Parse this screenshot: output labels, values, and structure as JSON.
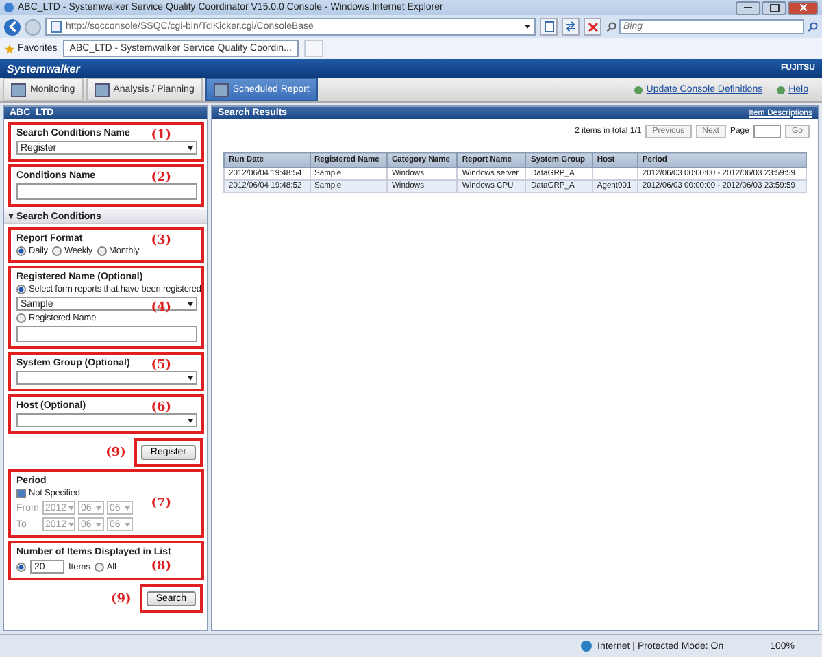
{
  "window": {
    "title": "ABC_LTD - Systemwalker Service Quality Coordinator V15.0.0 Console - Windows Internet Explorer"
  },
  "address_bar": {
    "url": "http://sqcconsole/SSQC/cgi-bin/TclKicker.cgi/ConsoleBase"
  },
  "search_box": {
    "placeholder": "Bing"
  },
  "favorites_bar": {
    "label": "Favorites",
    "tabs": [
      {
        "label": "ABC_LTD - Systemwalker Service Quality Coordin...",
        "selected": true
      }
    ]
  },
  "banner": {
    "logo": "Systemwalker",
    "brand": "FUJITSU"
  },
  "nav_tabs": [
    {
      "label": "Monitoring",
      "selected": false
    },
    {
      "label": "Analysis / Planning",
      "selected": false
    },
    {
      "label": "Scheduled Report",
      "selected": true
    }
  ],
  "nav_links": [
    "Update Console Definitions",
    "Help"
  ],
  "search_panel": {
    "title": "ABC_LTD",
    "search_conditions_name": {
      "label": "Search Conditions Name",
      "value": "Register",
      "callout": "(1)"
    },
    "conditions_name": {
      "label": "Conditions Name",
      "callout": "(2)"
    },
    "search_conditions": {
      "label": "Search Conditions",
      "expanded": true
    },
    "report_format": {
      "label": "Report Format",
      "callout": "(3)",
      "options": [
        {
          "label": "Daily",
          "selected": true
        },
        {
          "label": "Weekly",
          "selected": false
        },
        {
          "label": "Monthly",
          "selected": false
        }
      ]
    },
    "registered_name": {
      "label": "Registered Name (Optional)",
      "callout": "(4)",
      "value": "Sample",
      "options": [
        {
          "label": "Select form reports that have been registered",
          "selected": true
        },
        {
          "label": "Registered Name",
          "selected": false
        }
      ]
    },
    "system_group": {
      "label": "System Group (Optional)",
      "callout": "(5)"
    },
    "host": {
      "label": "Host (Optional)",
      "callout": "(6)"
    },
    "register_button": {
      "label": "Register",
      "callout": "(9)"
    },
    "period": {
      "label": "Period",
      "callout": "(7)",
      "not_specified": {
        "label": "Not Specified",
        "checked": true
      },
      "ranges": [
        {
          "label": "From",
          "year": "2012",
          "month": "06",
          "day": "06"
        },
        {
          "label": "To",
          "year": "2012",
          "month": "06",
          "day": "06"
        }
      ]
    },
    "items_in_list": {
      "label": "Number of Items Displayed in List",
      "callout": "(8)",
      "count": "20",
      "options": [
        {
          "label": "Items",
          "selected": true
        },
        {
          "label": "All",
          "selected": false
        }
      ]
    },
    "search_button": {
      "label": "Search",
      "callout": "(9)"
    }
  },
  "results_panel": {
    "title": "Search Results",
    "link": "Item Descriptions",
    "summary": "2 items in total 1/1",
    "buttons": [
      "Previous",
      "Next"
    ],
    "page_label": "Page",
    "go_button": "Go",
    "columns": [
      "Run Date",
      "Registered Name",
      "Category Name",
      "Report Name",
      "System Group",
      "Host",
      "Period"
    ],
    "rows": [
      [
        "2012/06/04 19:48:54",
        "Sample",
        "Windows",
        "Windows server",
        "DataGRP_A",
        "",
        "2012/06/03 00:00:00 - 2012/06/03 23:59:59"
      ],
      [
        "2012/06/04 19:48:52",
        "Sample",
        "Windows",
        "Windows CPU",
        "DataGRP_A",
        "Agent001",
        "2012/06/03 00:00:00 - 2012/06/03 23:59:59"
      ]
    ]
  },
  "status_bar": {
    "zone": "Internet | Protected Mode: On",
    "zoom": "100%"
  }
}
